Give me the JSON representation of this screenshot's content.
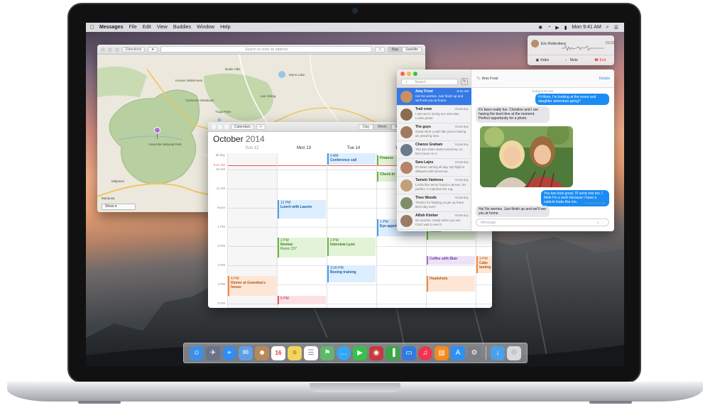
{
  "menubar": {
    "app_name": "Messages",
    "menus": [
      "File",
      "Edit",
      "View",
      "Buddies",
      "Window",
      "Help"
    ],
    "clock": "Mon 9:41 AM"
  },
  "maps": {
    "directions_label": "Directions",
    "search_placeholder": "Search or enter an address",
    "view_modes": [
      "Map",
      "Satellite"
    ],
    "show_label": "Show",
    "labels": {
      "tuolumne": "Tuolumne Meadows",
      "tioga": "Tioga Pass",
      "yosemite_np": "Yosemite National Park",
      "ellery": "Ellery Lake",
      "lee_vining": "Lee Vining",
      "mono": "Mono Lake",
      "bodie": "Bodie Hills",
      "wilderness": "Hoover Wilderness",
      "midpines": "Midpines",
      "mariposa": "Mariposa",
      "june": "June Lake"
    }
  },
  "calendar": {
    "title": "October",
    "year": "2014",
    "calendars_label": "Calendars",
    "view_modes": [
      "Day",
      "Week",
      "Month"
    ],
    "days": [
      "Sun 12",
      "Mon 13",
      "Tue 14",
      "W"
    ],
    "allday_label": "all-day",
    "now_label": "9:41 AM",
    "hours": [
      "10 AM",
      "11 AM",
      "Noon",
      "1 PM",
      "2 PM",
      "3 PM",
      "4 PM",
      "5 PM"
    ],
    "events": {
      "conference": {
        "time": "9 AM",
        "title": "Conference call"
      },
      "finance": {
        "title": "Finance"
      },
      "checkin": {
        "title": "Check-in"
      },
      "lunch": {
        "time": "12 PM",
        "title": "Lunch with Lauren"
      },
      "eye": {
        "time": "1 PM",
        "title": "Eye appointment"
      },
      "review": {
        "time": "2 PM",
        "title": "Review",
        "location": "Room 237"
      },
      "interview": {
        "time": "2 PM",
        "title": "Interview Lynn"
      },
      "kickoff": {
        "title": "Kickoff"
      },
      "coffee": {
        "title": "Coffee with Blair"
      },
      "cake": {
        "time": "3 PM",
        "title": "Cake tasting"
      },
      "boxing": {
        "time": "3:30 PM",
        "title": "Boxing training"
      },
      "headshots": {
        "title": "Headshots"
      },
      "dinner": {
        "time": "4 PM",
        "title": "Dinner at Grandma's house"
      },
      "five": {
        "time": "5 PM"
      }
    }
  },
  "facetime": {
    "caller": "Eric Rottenberg",
    "duration": "01:01",
    "video_label": "Video",
    "mute_label": "Mute",
    "end_label": "End"
  },
  "messages": {
    "search_placeholder": "Search",
    "to_label": "To:",
    "recipient": "Amy Frost",
    "details_label": "Details",
    "conversations": [
      {
        "name": "Amy Frost",
        "time": "9:41 AM",
        "preview": "Ha! No worries. Just finish up and we'll see you at home."
      },
      {
        "name": "Trail crew",
        "time": "Yesterday",
        "preview": "I see we're loving our new Mac. Looks great!"
      },
      {
        "name": "The guys",
        "time": "Yesterday",
        "preview": "Great shot! Looks like you're having an amazing time."
      },
      {
        "name": "Chance Graham",
        "time": "Yesterday",
        "preview": "The pre-order starts tomorrow, so let's move on it."
      },
      {
        "name": "Sara Lajos",
        "time": "Yesterday",
        "preview": "It's been raining all day. My flight is delayed until tomorrow."
      },
      {
        "name": "Tamsin Vantress",
        "time": "Yesterday",
        "preview": "Looks like we've found a winner. It's perfect. It matches the rug."
      },
      {
        "name": "Theo Woods",
        "time": "Yesterday",
        "preview": "Thanks for helping us get up there. Best day ever!"
      },
      {
        "name": "Allish Kimber",
        "time": "Yesterday",
        "preview": "No worries, ready when you are. Can't wait to see it."
      }
    ],
    "thread": {
      "stamp1": "Today 9:40 AM",
      "out1": "Hi Mom, I'm looking at the moon and daughter adventure going?",
      "in1": "It's been really fun. Christine and I are having the best time at the moment. Perfect opportunity for a photo.",
      "out2": "You two look great. I'll send one too. I think I'm a work because I have a cubicle looks like me.",
      "read": "Read 9:41 AM",
      "in2": "Ha! No worries. Just finish up and we'll see you at home."
    },
    "input_placeholder": "iMessage"
  },
  "dock": {
    "apps": [
      "finder-icon",
      "launchpad-icon",
      "safari-icon",
      "mail-icon",
      "contacts-icon",
      "calendar-icon",
      "notes-icon",
      "reminders-icon",
      "maps-icon",
      "messages-icon",
      "facetime-icon",
      "photo-booth-icon",
      "numbers-icon",
      "keynote-icon",
      "itunes-icon",
      "ibooks-icon",
      "app-store-icon",
      "system-preferences-icon"
    ],
    "calendar_day": "16",
    "colors": {
      "finder": "#3d8fe3",
      "launchpad": "#6b7487",
      "safari": "#2e8ef2",
      "mail": "#5f9fe8",
      "contacts": "#b58a5b",
      "calendar": "#ffffff",
      "notes": "#f4d55a",
      "reminders": "#ffffff",
      "maps": "#5fb86a",
      "messages": "#33a7f5",
      "facetime": "#38c04a",
      "photobooth": "#c53b3b",
      "numbers": "#3ca54a",
      "keynote": "#2f7be0",
      "itunes": "#f0334f",
      "ibooks": "#f28b20",
      "appstore": "#2f8ff2",
      "sysprefs": "#7d7f85",
      "downloads": "#4ba0e8",
      "trash": "#d7dadf"
    }
  }
}
